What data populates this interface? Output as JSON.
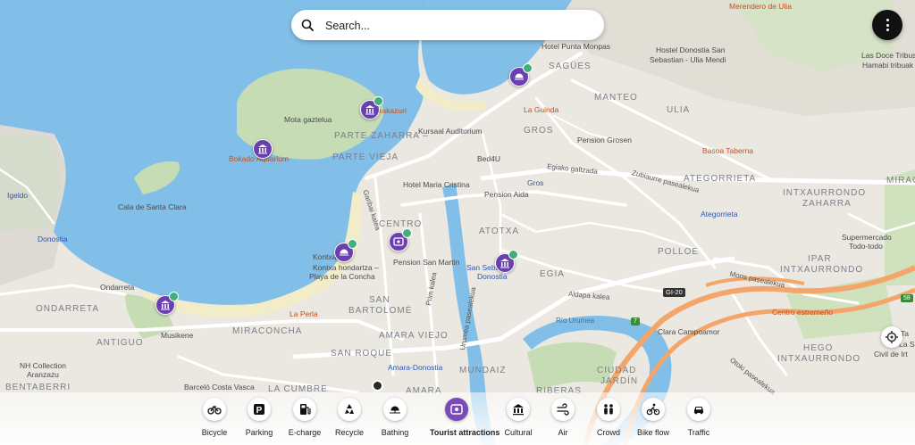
{
  "search": {
    "placeholder": "Search..."
  },
  "districts": {
    "parte_zaharra": "PARTE ZAHARRA –",
    "parte_vieja": "PARTE VIEJA",
    "gros": "GROS",
    "centro": "CENTRO",
    "atotxa": "ATOTXA",
    "egia": "EGIA",
    "polloe": "POLLOE",
    "manteo": "MANTEO",
    "ulia": "ULIA",
    "sagues": "SAGÜES",
    "ategorrieta": "ATEGORRIETA",
    "intxaurrondo_zaharra_1": "INTXAURRONDO",
    "intxaurrondo_zaharra_2": "ZAHARRA",
    "ipar_1": "IPAR",
    "ipar_2": "INTXAURRONDO",
    "hego_1": "HEGO",
    "hego_2": "INTXAURRONDO",
    "miracruz": "MIRAC",
    "ondarreta": "ONDARRETA",
    "antiguo": "ANTIGUO",
    "miraconcha": "MIRACONCHA",
    "san_bartolome_1": "SAN",
    "san_bartolome_2": "BARTOLOMÉ",
    "amara_viejo": "AMARA VIEJO",
    "san_roque": "SAN ROQUE",
    "mundaiz": "MUNDAIZ",
    "ciudad_jardin_1": "CIUDAD",
    "ciudad_jardin_2": "JARDÍN",
    "bentaberri": "BENTABERRI",
    "la_cumbre": "LA CUMBRE",
    "amara": "AMARA",
    "riberas": "RIBERAS"
  },
  "pois": {
    "merendero": "Merendero de Ulia",
    "hotel_punta": "Hotel Punta Monpas",
    "hostel_1": "Hostel Donostia San",
    "hostel_2": "Sebastian - Ulia Mendi",
    "las_doce_1": "Las Doce Tribus",
    "las_doce_2": "Hamabi tribuak",
    "la_guinda": "La Guinda",
    "kursaal": "Kursaal Auditorium",
    "pension_grosen": "Pension Grosen",
    "basoa": "Basoa Taberna",
    "mota": "Mota gaztelua",
    "kazuri": "Txakazuri",
    "bokado": "Bokado Aquarium",
    "bed4u": "Bed4U",
    "hotel_maria": "Hotel Maria Cristina",
    "pension_aida": "Pension Aida",
    "gros_station": "Gros",
    "ategorrieta_station": "Ategorrieta",
    "supermercado_1": "Supermercado",
    "supermercado_2": "Todo-todo",
    "igeldo": "Igeldo",
    "donostia": "Donostia",
    "cala": "Cala de Santa Clara",
    "kontxa": "Kontxa",
    "kontxa_h_1": "Kontxa hondartza –",
    "kontxa_h_2": "Playa de la Concha",
    "pension_sm": "Pension San Martin",
    "san_seb_1": "San Seba",
    "san_seb_2": "Donostia",
    "ondarreta_poi": "Ondarreta",
    "la_perla": "La Perla",
    "musikene": "Musikene",
    "nh_1": "NH Collection",
    "nh_2": "Aranzazu",
    "barcelo": "Barceló Costa Vasca",
    "amara_donostia": "Amara-Donostia",
    "clara": "Clara Campoamor",
    "centro_estremeno": "Centro estremeño",
    "la_salle_1": "La Sal",
    "la_salle_2": "Civil de Irt",
    "ta": "Ta"
  },
  "streets": {
    "garibai": "Garibai kalea",
    "egiako": "Egiako galtzada",
    "zubiaurre": "Zubiaurre pasealekua",
    "aldapa": "Aldapa kalea",
    "prim": "Prim kalea",
    "urumea": "Urumea pasealekua",
    "rio": "Río Urumea",
    "mons": "Mons pasealekua",
    "oleta": "Otoki pasealekua",
    "gi20": "GI-20",
    "n7": "7",
    "n58": "58"
  },
  "categories": [
    {
      "label": "Bicycle",
      "icon": "bicycle-icon"
    },
    {
      "label": "Parking",
      "icon": "parking-icon"
    },
    {
      "label": "E-charge",
      "icon": "fuel-pump-icon"
    },
    {
      "label": "Recycle",
      "icon": "recycle-icon"
    },
    {
      "label": "Bathing",
      "icon": "beach-icon"
    },
    {
      "label": "Tourist attractions",
      "icon": "map-pin-icon",
      "active": true
    },
    {
      "label": "Cultural",
      "icon": "museum-icon"
    },
    {
      "label": "Air",
      "icon": "wind-icon"
    },
    {
      "label": "Crowd",
      "icon": "people-icon"
    },
    {
      "label": "Bike flow",
      "icon": "cyclist-icon"
    },
    {
      "label": "Traffic",
      "icon": "car-icon"
    }
  ],
  "colors": {
    "water": "#82bfe8",
    "beach": "#f3ecc8",
    "park": "#c5dcb5",
    "accent": "#6b3fb0",
    "highway": "#f4a56a"
  }
}
